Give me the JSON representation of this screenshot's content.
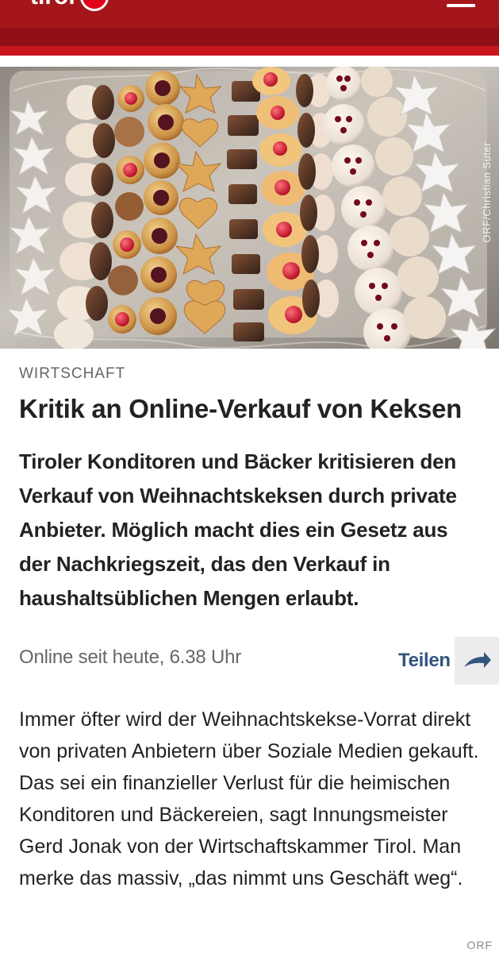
{
  "header": {
    "brand": "tirol",
    "menu_icon": "menu-icon"
  },
  "hero": {
    "photo_credit": "ORF/Christian Suter"
  },
  "article": {
    "category": "WIRTSCHAFT",
    "title": "Kritik an Online-Verkauf von Keksen",
    "lead": "Tiroler Konditoren und Bäcker kritisieren den Verkauf von Weihnachtskeksen durch private Anbieter. Möglich macht dies ein Gesetz aus der Nachkriegszeit, das den Verkauf in haushaltsüblichen Mengen erlaubt.",
    "meta": "Online seit heute, 6.38 Uhr",
    "share": "Teilen",
    "body": "Immer öfter wird der Weihnachtskekse-Vorrat direkt von privaten Anbietern über Soziale Medien gekauft. Das sei ein finanzieller Verlust für die heimischen Konditoren und Bäckereien, sagt Innungsmeister Gerd Jonak von der Wirtschaftskammer Tirol. Man merke das massiv, „das nimmt uns Geschäft weg“.",
    "source": "ORF"
  },
  "colors": {
    "header": "#a4161a",
    "accent": "#c8161d",
    "share_text": "#345480",
    "muted_text": "#666666"
  },
  "icons": {
    "share": "share-arrow-icon",
    "logo": "orf-circle-icon"
  }
}
